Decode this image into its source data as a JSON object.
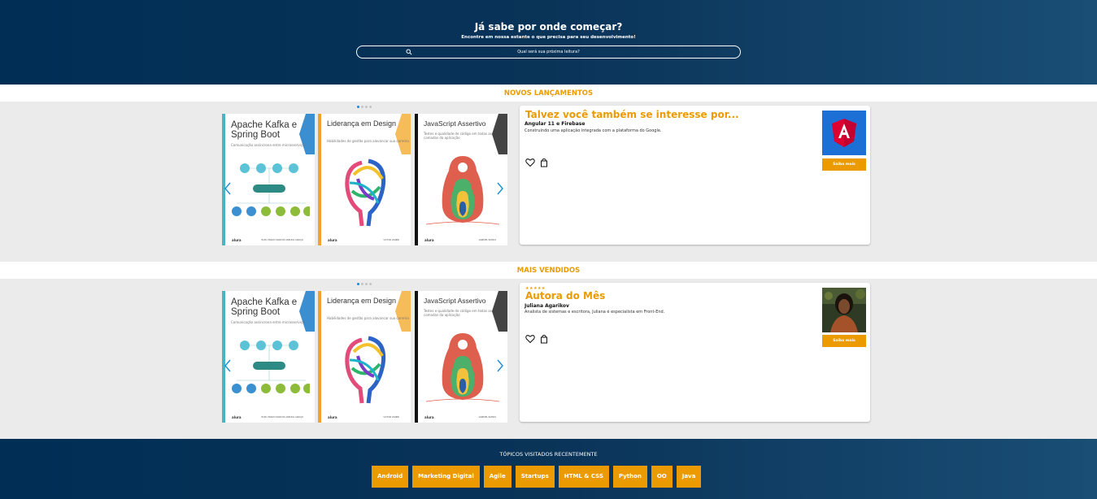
{
  "hero": {
    "title": "Já sabe por onde começar?",
    "subtitle": "Encontre em nossa estante o que precisa para seu desenvolvimento!",
    "search_placeholder": "Qual será sua próxima leitura?"
  },
  "sections": [
    {
      "heading": "NOVOS LANÇAMENTOS",
      "card": {
        "stars": "",
        "title": "Talvez você também se interesse por...",
        "name": "Angular 11 e Firebase",
        "description": "Construindo uma aplicação integrada com a plataforma do Google.",
        "button": "Saiba mais",
        "image_icon": "angular-logo-icon"
      }
    },
    {
      "heading": "MAIS VENDIDOS",
      "card": {
        "stars": "★★★★★",
        "title": "Autora do Mês",
        "name": "Juliana Agarikov",
        "description": "Analista de sistemas e escritora, Juliana é especialista em Front-End.",
        "button": "Saiba mais",
        "image_icon": "author-photo"
      }
    }
  ],
  "books": [
    {
      "title": "Apache Kafka e Spring Boot",
      "subtitle": "Comunicação assíncrona entre microsserviços",
      "brand": "alura",
      "author": "ELIEL PRADO MARCOS ARRUDA ARAUJO",
      "color": "#4ab3c4"
    },
    {
      "title": "Liderança em Design",
      "subtitle": "Habilidades de gestão para alavancar sua carreira",
      "brand": "alura",
      "author": "VICTOR ZANINI",
      "color": "#f0a22e"
    },
    {
      "title": "JavaScript Assertivo",
      "subtitle": "Testes e qualidade de código em todas as camadas da aplicação",
      "brand": "alura",
      "author": "GABRIEL RAMOS",
      "color": "#111111"
    }
  ],
  "footer": {
    "title": "TÓPICOS VISITADOS RECENTEMENTE",
    "tags": [
      "Android",
      "Marketing Digital",
      "Agile",
      "Startups",
      "HTML & CSS",
      "Python",
      "OO",
      "Java"
    ]
  },
  "colors": {
    "accent": "#eb9b00",
    "navy": "#002e55",
    "dot_active": "#1b8bd0"
  }
}
